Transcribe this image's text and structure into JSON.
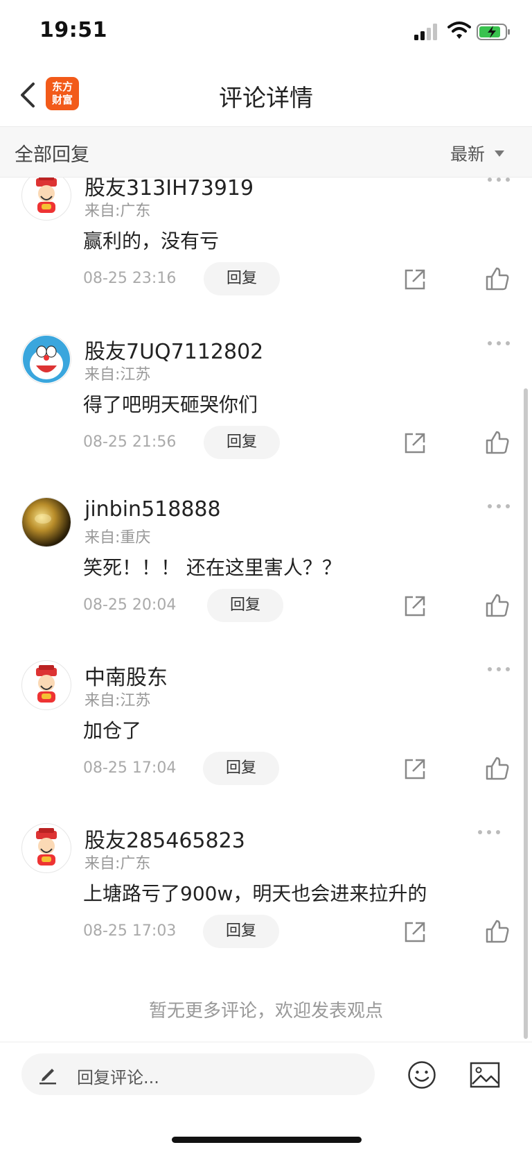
{
  "status_bar": {
    "time": "19:51"
  },
  "nav": {
    "logo_text": "东方财富",
    "title": "评论详情"
  },
  "filter": {
    "all_label": "全部回复",
    "sort_label": "最新"
  },
  "comments": [
    {
      "username": "股友313IH73919",
      "location": "来自:广东",
      "content": "赢利的，没有亏",
      "time": "08-25 23:16",
      "reply_label": "回复",
      "avatar": "caishen-avatar"
    },
    {
      "username": "股友7UQ7112802",
      "location": "来自:江苏",
      "content": "得了吧明天砸哭你们",
      "time": "08-25 21:56",
      "reply_label": "回复",
      "avatar": "doraemon-avatar"
    },
    {
      "username": "jinbin518888",
      "location": "来自:重庆",
      "content": "笑死！！！ 还在这里害人？？",
      "time": "08-25 20:04",
      "reply_label": "回复",
      "avatar": "golden-orb-avatar"
    },
    {
      "username": "中南股东",
      "location": "来自:江苏",
      "content": "加仓了",
      "time": "08-25 17:04",
      "reply_label": "回复",
      "avatar": "caishen-avatar"
    },
    {
      "username": "股友285465823",
      "location": "来自:广东",
      "content": "上塘路亏了900w，明天也会进来拉升的",
      "time": "08-25 17:03",
      "reply_label": "回复",
      "avatar": "caishen-avatar"
    }
  ],
  "no_more_text": "暂无更多评论，欢迎发表观点",
  "bottom_bar": {
    "reply_placeholder": "回复评论..."
  }
}
